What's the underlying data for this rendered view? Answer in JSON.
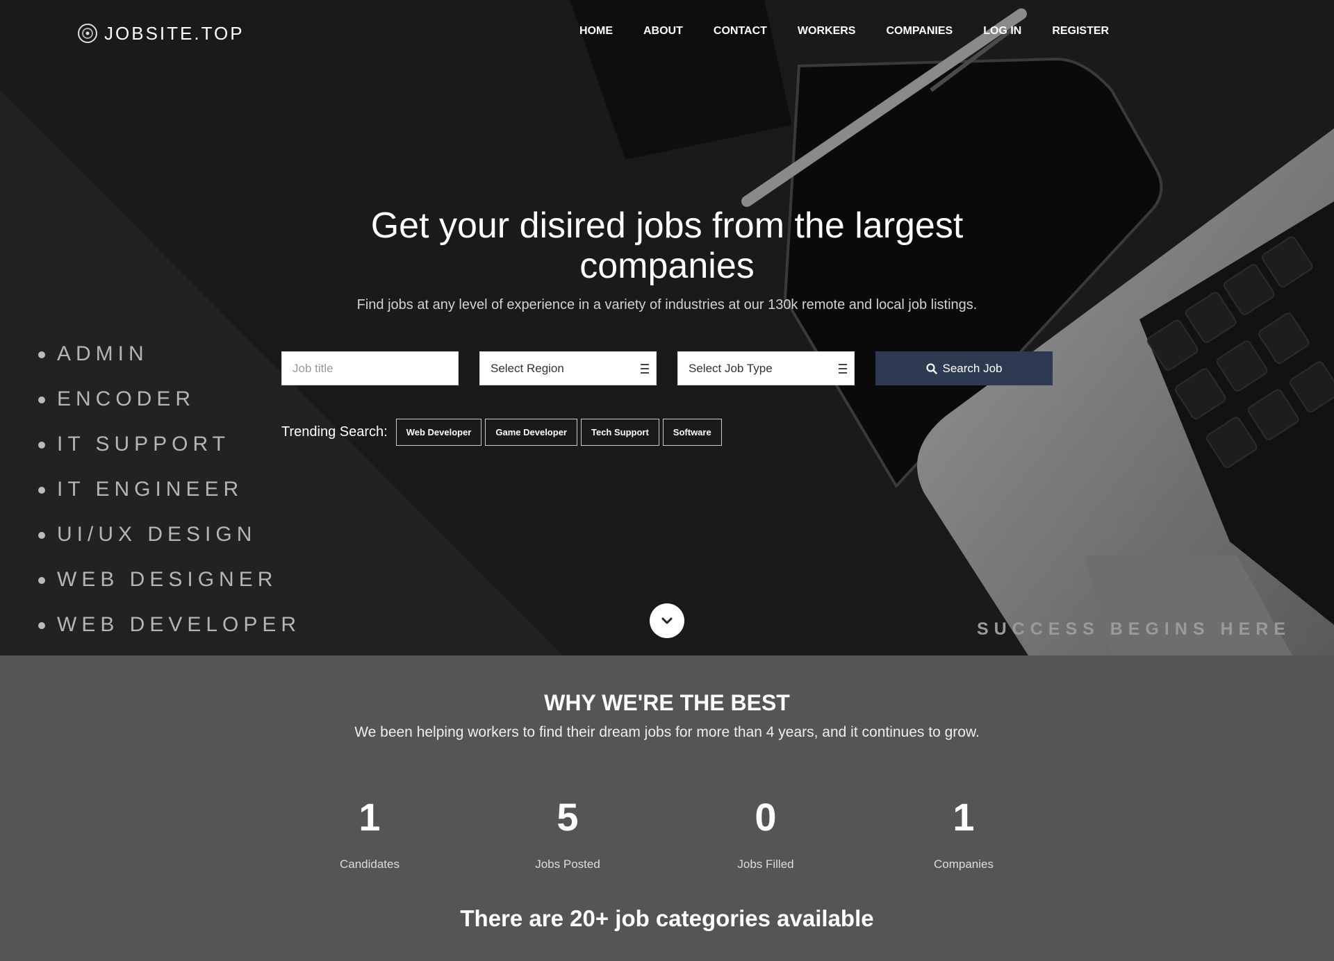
{
  "header": {
    "logo_text": "JOBSITE.TOP",
    "nav": [
      "HOME",
      "ABOUT",
      "CONTACT",
      "WORKERS",
      "COMPANIES",
      "LOG IN",
      "REGISTER"
    ]
  },
  "hero": {
    "headline": "Get your disired jobs from the largest companies",
    "subheadline": "Find jobs at any level of experience in a variety of industries at our 130k remote and local job listings.",
    "side_list": [
      "ADMIN",
      "ENCODER",
      "IT SUPPORT",
      "IT ENGINEER",
      "UI/UX DESIGN",
      "WEB DESIGNER",
      "WEB DEVELOPER"
    ],
    "search": {
      "job_title_placeholder": "Job title",
      "region_value": "Select Region",
      "job_type_value": "Select Job Type",
      "button_label": "Search Job"
    },
    "trending": {
      "label": "Trending Search:",
      "tags": [
        "Web Developer",
        "Game Developer",
        "Tech Support",
        "Software"
      ]
    },
    "tagline": "SUCCESS BEGINS HERE"
  },
  "why": {
    "title": "WHY WE'RE THE BEST",
    "subtitle": "We been helping workers to find their dream jobs for more than 4 years, and it continues to grow.",
    "stats": [
      {
        "value": "1",
        "label": "Candidates"
      },
      {
        "value": "5",
        "label": "Jobs Posted"
      },
      {
        "value": "0",
        "label": "Jobs Filled"
      },
      {
        "value": "1",
        "label": "Companies"
      }
    ],
    "categories_heading": "There are 20+ job categories available"
  },
  "icons": {
    "logo": "globe-icon",
    "menu": "list-icon",
    "search": "search-icon",
    "scroll": "chevron-down-icon"
  },
  "colors": {
    "hero_bg": "#161616",
    "section_bg": "#555555",
    "search_button": "#2e3a52"
  }
}
